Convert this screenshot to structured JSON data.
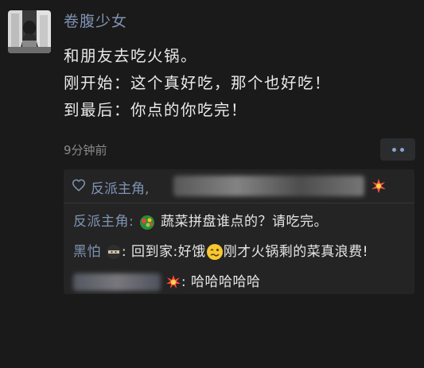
{
  "author": {
    "name": "卷腹少女",
    "avatar_icon": "avatar-photo"
  },
  "post": {
    "lines": [
      "和朋友去吃火锅。",
      "刚开始：这个真好吃，那个也好吃！",
      "到最后：你点的你吃完！"
    ],
    "timestamp": "9分钟前"
  },
  "likes": {
    "icon": "heart-icon",
    "first_name": "反派主角",
    "separator": ",",
    "end_icon": "fire-icon"
  },
  "comments": [
    {
      "name": "反派主角",
      "separator": ":",
      "icon": "salad-icon",
      "text": "蔬菜拼盘谁点的？请吃完。"
    },
    {
      "name": "黑怕",
      "name_icon": "ninja-icon",
      "separator": ": ",
      "text_before": "回到家:好饿",
      "icon": "woozy-face-icon",
      "text_after": "刚才火锅剩的菜真浪费!"
    },
    {
      "name_icon": "explosion-icon",
      "separator": ": ",
      "text": "哈哈哈哈哈"
    }
  ],
  "colors": {
    "background": "#1a1a1a",
    "name_blue": "#7f93b3",
    "box_background": "#242424"
  }
}
